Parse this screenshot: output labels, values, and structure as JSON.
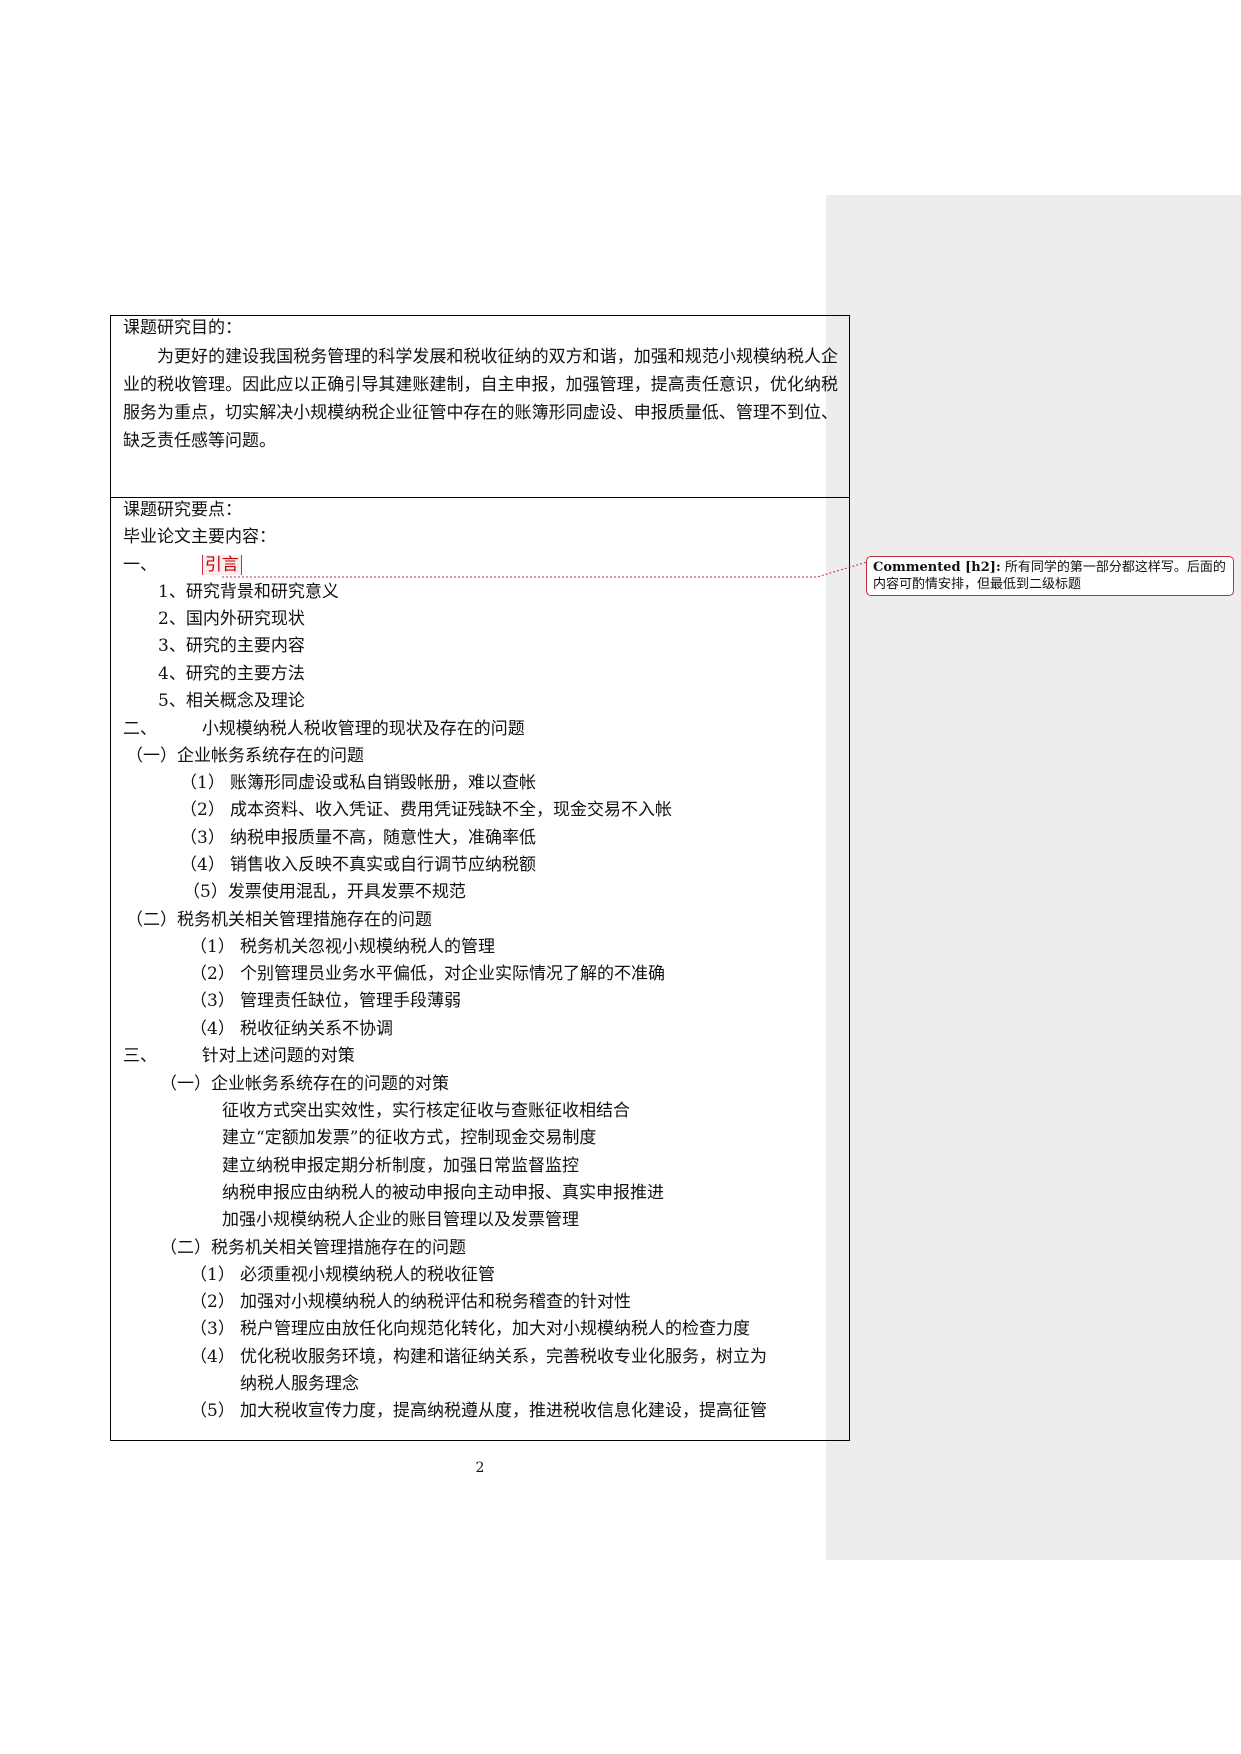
{
  "purpose": {
    "heading": "课题研究目的：",
    "paragraph": "为更好的建设我国税务管理的科学发展和税收征纳的双方和谐，加强和规范小规模纳税人企业的税收管理。因此应以正确引导其建账建制，自主申报，加强管理，提高责任意识，优化纳税服务为重点，切实解决小规模纳税企业征管中存在的账簿形同虚设、申报质量低、管理不到位、缺乏责任感等问题。"
  },
  "outline": {
    "heading": "课题研究要点：",
    "subheading": "毕业论文主要内容：",
    "sections": [
      {
        "number": "一、",
        "title": "引言",
        "items": [
          "1、研究背景和研究意义",
          "2、国内外研究现状",
          "3、研究的主要内容",
          "4、研究的主要方法",
          "5、相关概念及理论"
        ]
      },
      {
        "number": "二、",
        "title": "小规模纳税人税收管理的现状及存在的问题",
        "subsections": [
          {
            "title": "（一）企业帐务系统存在的问题",
            "items": [
              {
                "num": "（1）",
                "text": "账簿形同虚设或私自销毁帐册，难以查帐"
              },
              {
                "num": "（2）",
                "text": "成本资料、收入凭证、费用凭证残缺不全，现金交易不入帐"
              },
              {
                "num": "（3）",
                "text": "纳税申报质量不高，随意性大，准确率低"
              },
              {
                "num": "（4）",
                "text": "销售收入反映不真实或自行调节应纳税额"
              },
              {
                "num": "",
                "text": "（5）发票使用混乱，开具发票不规范"
              }
            ]
          },
          {
            "title": "（二）税务机关相关管理措施存在的问题",
            "items": [
              {
                "num": "（1）",
                "text": "税务机关忽视小规模纳税人的管理"
              },
              {
                "num": "（2）",
                "text": "个别管理员业务水平偏低，对企业实际情况了解的不准确"
              },
              {
                "num": "（3）",
                "text": "管理责任缺位，管理手段薄弱"
              },
              {
                "num": "（4）",
                "text": "税收征纳关系不协调"
              }
            ]
          }
        ]
      },
      {
        "number": "三、",
        "title": "针对上述问题的对策",
        "subsections": [
          {
            "title": "（一）企业帐务系统存在的问题的对策",
            "items": [
              "征收方式突出实效性，实行核定征收与查账征收相结合",
              "建立“定额加发票”的征收方式，控制现金交易制度",
              "建立纳税申报定期分析制度，加强日常监督监控",
              "纳税申报应由纳税人的被动申报向主动申报、真实申报推进",
              "加强小规模纳税人企业的账目管理以及发票管理"
            ]
          },
          {
            "title": "（二）税务机关相关管理措施存在的问题",
            "items": [
              {
                "num": "（1）",
                "text": "必须重视小规模纳税人的税收征管"
              },
              {
                "num": "（2）",
                "text": "加强对小规模纳税人的纳税评估和税务稽查的针对性"
              },
              {
                "num": "（3）",
                "text": "税户管理应由放任化向规范化转化，加大对小规模纳税人的检查力度"
              },
              {
                "num": "（4）",
                "text": "优化税收服务环境，构建和谐征纳关系，完善税收专业化服务，树立为",
                "continuation": "纳税人服务理念"
              },
              {
                "num": "（5）",
                "text": "加大税收宣传力度，提高纳税遵从度，推进税收信息化建设，提高征管"
              }
            ]
          }
        ]
      }
    ]
  },
  "comment": {
    "author": "Commented [h2]:",
    "text": "所有同学的第一部分都这样写。后面的内容可酌情安排，但最低到二级标题"
  },
  "page_number": "2",
  "colors": {
    "comment_border": "#c0303a",
    "margin_background": "#ededed"
  }
}
